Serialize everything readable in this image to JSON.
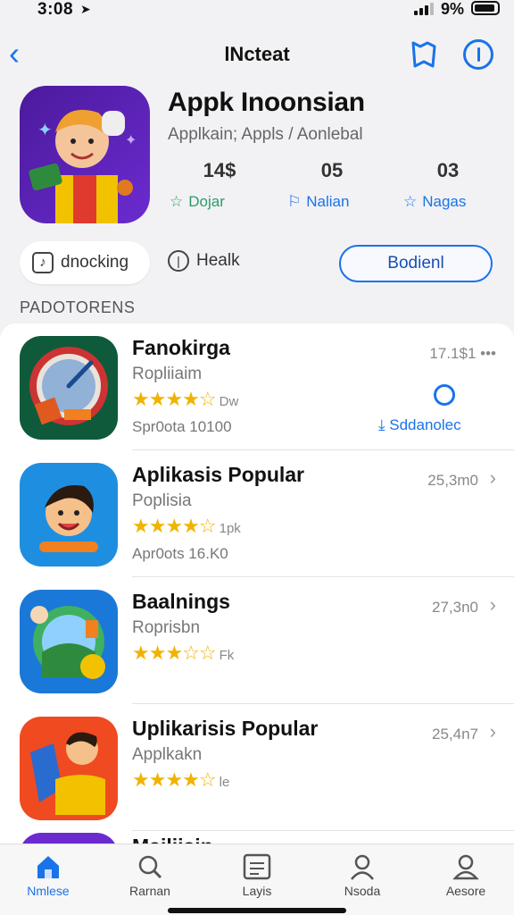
{
  "status": {
    "time": "3:08",
    "battery": "9%"
  },
  "nav": {
    "title": "lNcteat"
  },
  "hero": {
    "title": "Appk Inoonsian",
    "subtitle": "Applkain; Appls / Aonlebal",
    "stats": [
      {
        "value": "14$",
        "label": "Dojar"
      },
      {
        "value": "05",
        "label": "Nalian"
      },
      {
        "value": "03",
        "label": "Nagas"
      }
    ]
  },
  "tabs": {
    "active": "dnocking",
    "other": "Healk",
    "button": "Bodienl"
  },
  "section_title": "PADOTORENS",
  "apps": [
    {
      "name": "Fanokirga",
      "category": "Ropliiaim",
      "stars": "★★★★☆",
      "count": "Dw",
      "meta": "Spr0ota 10100",
      "size": "17.1$1 •••",
      "action": "Sddanolec"
    },
    {
      "name": "Aplikasis Popular",
      "category": "Poplisia",
      "stars": "★★★★☆",
      "count": "1pk",
      "meta": "Apr0ots 16.K0",
      "size": "25,3m0"
    },
    {
      "name": "Baalnings",
      "category": "Roprisbn",
      "stars": "★★★☆☆",
      "count": "Fk",
      "meta": "",
      "size": "27,3n0"
    },
    {
      "name": "Uplikarisis Popular",
      "category": "Applkakn",
      "stars": "★★★★☆",
      "count": "le",
      "meta": "",
      "size": "25,4n7"
    },
    {
      "name": "Mailiisin",
      "category": "",
      "stars": "",
      "count": "",
      "meta": "",
      "size": ""
    }
  ],
  "tabbar": [
    {
      "label": "Nmlese",
      "icon": "home-icon"
    },
    {
      "label": "Rarnan",
      "icon": "search-icon"
    },
    {
      "label": "Layis",
      "icon": "list-icon"
    },
    {
      "label": "Nsoda",
      "icon": "person-icon"
    },
    {
      "label": "Aesore",
      "icon": "account-icon"
    }
  ],
  "colors": {
    "accent": "#1a73e8",
    "star": "#f0b400",
    "green": "#2a9d6a"
  }
}
